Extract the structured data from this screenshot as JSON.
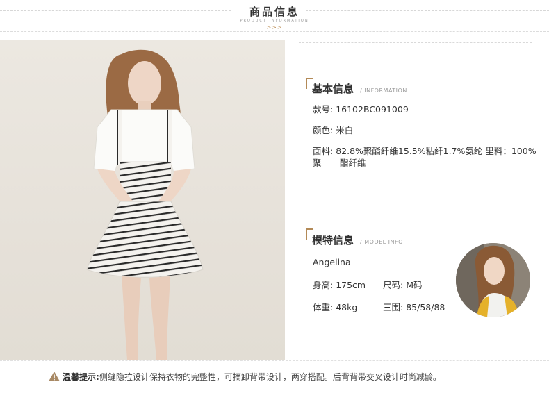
{
  "header": {
    "title": "商品信息",
    "subtitle": "PRODUCT INFORMATION",
    "arrows": ">>>"
  },
  "basic_info": {
    "title": "基本信息",
    "title_en": "/ INFORMATION",
    "style_no_label": "款号:",
    "style_no": "16102BC091009",
    "color_label": "颜色:",
    "color": "米白",
    "fabric_label": "面料:",
    "fabric_line1": "82.8%聚酯纤维15.5%粘纤1.7%氨纶 里料：100%聚",
    "fabric_line2": "酯纤维"
  },
  "model_info": {
    "title": "模特信息",
    "title_en": "/ MODEL INFO",
    "name": "Angelina",
    "height_label": "身高:",
    "height": "175cm",
    "size_label": "尺码:",
    "size": "M码",
    "weight_label": "体重:",
    "weight": "48kg",
    "measure_label": "三围:",
    "measure": "85/58/88"
  },
  "tip": {
    "label": "温馨提示:",
    "text": "侧缝隐拉设计保持衣物的完整性，可摘卸背带设计，两穿搭配。后背背带交叉设计时尚减龄。"
  },
  "colors": {
    "accent": "#b38a57",
    "text": "#333333",
    "muted": "#999999"
  }
}
